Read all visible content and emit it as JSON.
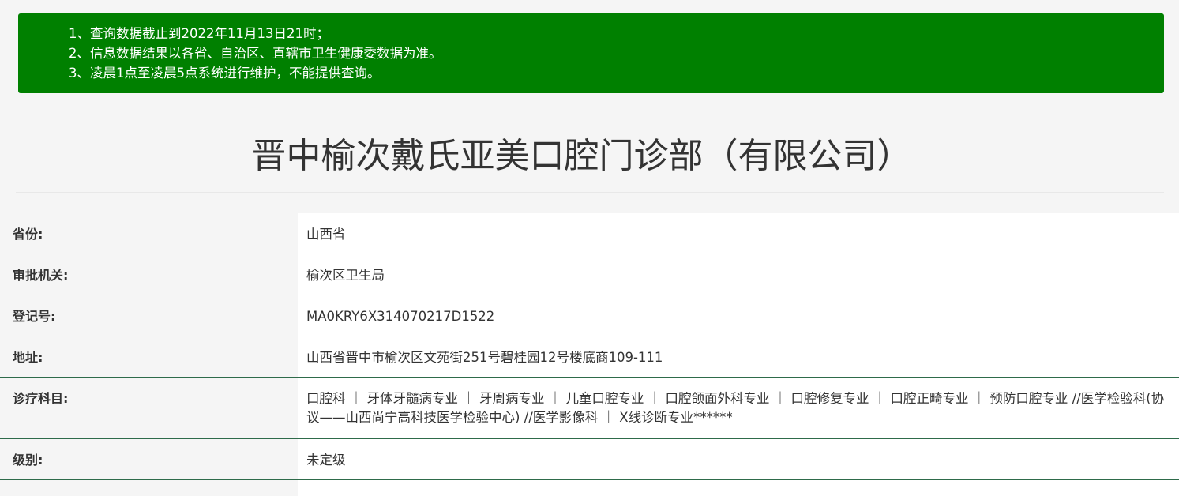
{
  "notice": {
    "lines": [
      "1、查询数据截止到2022年11月13日21时；",
      "2、信息数据结果以各省、自治区、直辖市卫生健康委数据为准。",
      "3、凌晨1点至凌晨5点系统进行维护，不能提供查询。"
    ]
  },
  "title": "晋中榆次戴氏亚美口腔门诊部（有限公司）",
  "fields": [
    {
      "label": "省份:",
      "value": "山西省"
    },
    {
      "label": "审批机关:",
      "value": "榆次区卫生局"
    },
    {
      "label": "登记号:",
      "value": "MA0KRY6X314070217D1522"
    },
    {
      "label": "地址:",
      "value": "山西省晋中市榆次区文苑街251号碧桂园12号楼底商109-111"
    },
    {
      "label": "诊疗科目:",
      "value": "口腔科 ｜ 牙体牙髓病专业 ｜ 牙周病专业 ｜ 儿童口腔专业 ｜ 口腔颌面外科专业 ｜ 口腔修复专业 ｜ 口腔正畸专业 ｜ 预防口腔专业 //医学检验科(协议——山西尚宁高科技医学检验中心) //医学影像科 ｜ X线诊断专业******"
    },
    {
      "label": "级别:",
      "value": "未定级"
    }
  ],
  "colors": {
    "notice_bg": "#008000",
    "row_divider": "#2e6b4a"
  }
}
